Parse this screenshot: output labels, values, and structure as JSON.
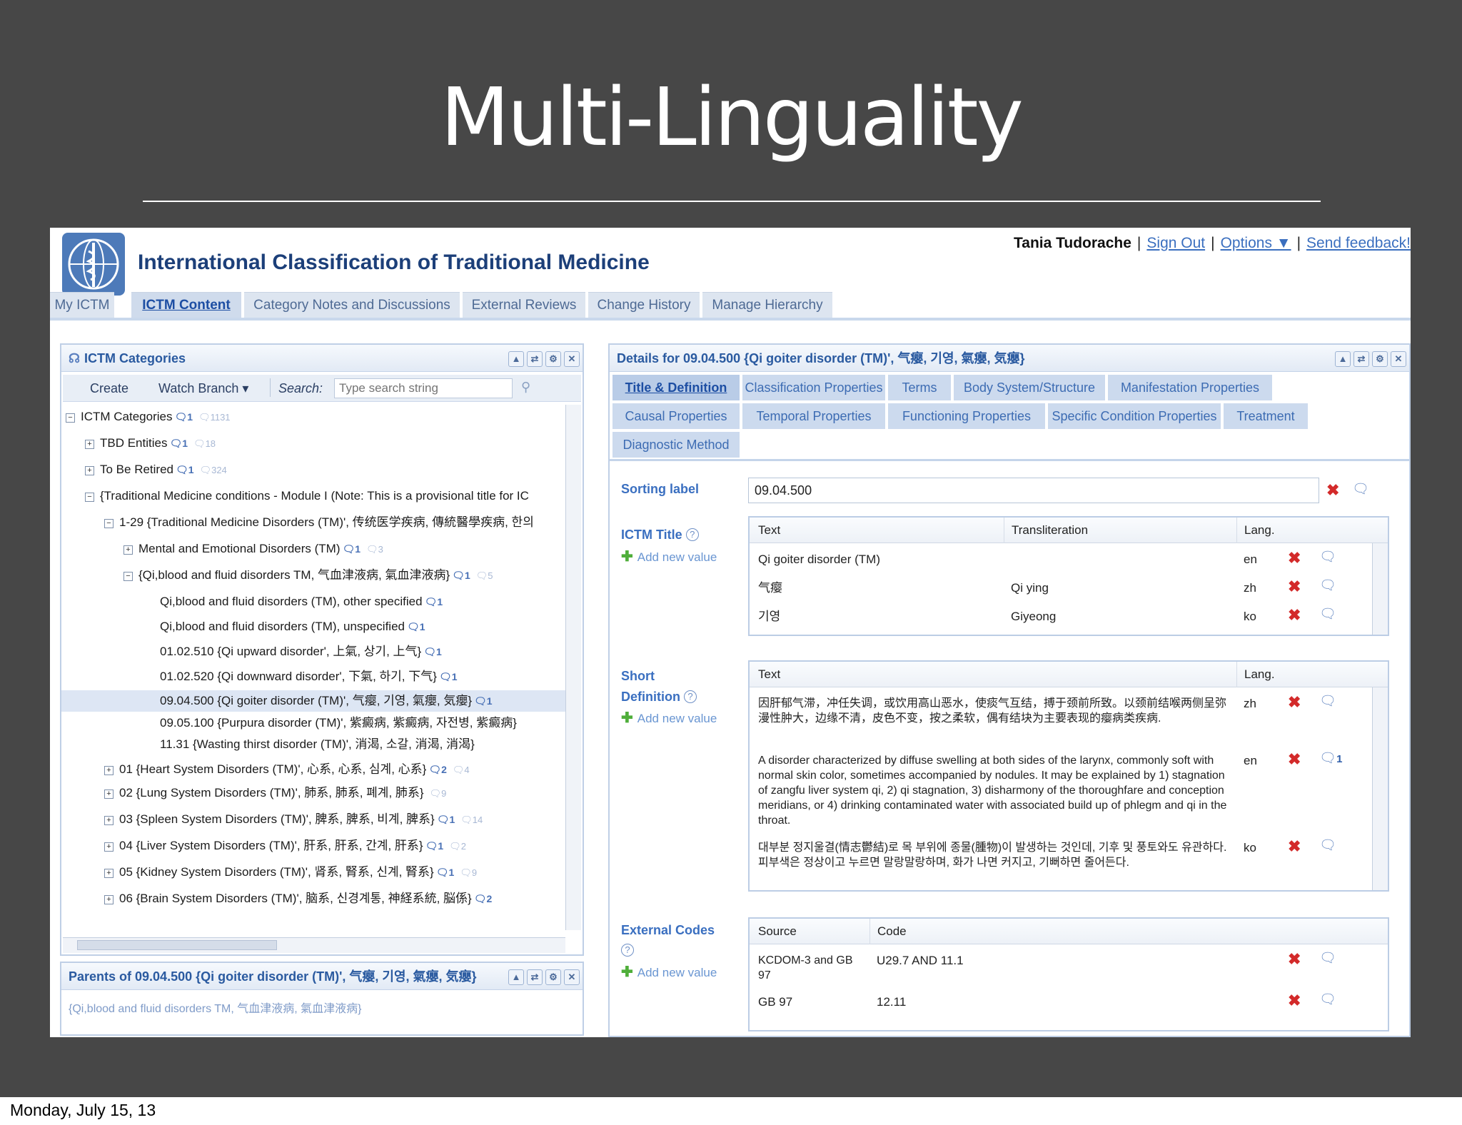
{
  "slide": {
    "title": "Multi-Linguality",
    "footer": "Monday, July 15, 13"
  },
  "app": {
    "title": "International Classification of Traditional Medicine",
    "user": "Tania Tudorache",
    "sign_out": "Sign Out",
    "options": "Options ▼",
    "feedback": "Send feedback!",
    "tabs": [
      "My ICTM",
      "ICTM Content",
      "Category Notes and Discussions",
      "External Reviews",
      "Change History",
      "Manage Hierarchy"
    ]
  },
  "tree_panel": {
    "title": "ICTM Categories",
    "create": "Create",
    "watch": "Watch Branch ▾",
    "search_label": "Search:",
    "search_placeholder": "Type search string",
    "rows": [
      {
        "text": "ICTM Categories",
        "n": "1",
        "m": "1131"
      },
      {
        "text": "TBD Entities",
        "n": "1",
        "m": "18"
      },
      {
        "text": "To Be Retired",
        "n": "1",
        "m": "324"
      },
      {
        "text": "{Traditional Medicine conditions - Module I (Note: This is a provisional title for IC",
        "n": "",
        "m": ""
      },
      {
        "text": "1-29 {Traditional Medicine Disorders (TM)', 传统医学疾病, 傳統醫學疾病, 한의",
        "n": "",
        "m": ""
      },
      {
        "text": "Mental and Emotional Disorders (TM)",
        "n": "1",
        "m": "3"
      },
      {
        "text": "{Qi,blood and fluid disorders TM, 气血津液病, 氣血津液病}",
        "n": "1",
        "m": "5"
      },
      {
        "text": "Qi,blood and fluid disorders (TM), other specified",
        "n": "1",
        "m": ""
      },
      {
        "text": "Qi,blood and fluid disorders (TM), unspecified",
        "n": "1",
        "m": ""
      },
      {
        "text": "01.02.510 {Qi upward disorder', 上氣, 상기, 上气}",
        "n": "1",
        "m": ""
      },
      {
        "text": "01.02.520 {Qi downward disorder', 下氣, 하기, 下气}",
        "n": "1",
        "m": ""
      },
      {
        "text": "09.04.500 {Qi goiter disorder (TM)', 气瘿, 기영, 氣癭, 気癭}",
        "n": "1",
        "m": ""
      },
      {
        "text": "09.05.100 {Purpura disorder (TM)', 紫癜病, 紫癜病, 자전병, 紫癜病}",
        "n": "",
        "m": ""
      },
      {
        "text": "11.31 {Wasting thirst disorder (TM)', 消渴, 소갈, 消渴, 消渴}",
        "n": "",
        "m": ""
      },
      {
        "text": "01 {Heart System Disorders (TM)', 心系, 心系, 심계, 心系}",
        "n": "2",
        "m": "4"
      },
      {
        "text": "02 {Lung System Disorders (TM)', 肺系, 肺系, 폐계, 肺系}",
        "n": "",
        "m": "9"
      },
      {
        "text": "03 {Spleen System Disorders (TM)', 脾系, 脾系, 비계, 脾系}",
        "n": "1",
        "m": "14"
      },
      {
        "text": "04 {Liver System Disorders (TM)', 肝系, 肝系, 간계, 肝系}",
        "n": "1",
        "m": "2"
      },
      {
        "text": "05 {Kidney System Disorders (TM)', 肾系, 腎系, 신계, 腎系}",
        "n": "1",
        "m": "9"
      },
      {
        "text": "06 {Brain System Disorders (TM)', 脑系, 신경계통, 神経系統, 脳係}",
        "n": "2",
        "m": ""
      }
    ]
  },
  "parents_panel": {
    "title": "Parents of 09.04.500 {Qi goiter disorder (TM)', 气瘿, 기영, 氣癭, 気癭}",
    "value": "{Qi,blood and fluid disorders TM, 气血津液病, 氣血津液病}"
  },
  "details": {
    "title": "Details for 09.04.500 {Qi goiter disorder (TM)', 气瘿, 기영, 氣癭, 気癭}",
    "tabs": [
      "Title & Definition",
      "Classification Properties",
      "Terms",
      "Body System/Structure",
      "Manifestation Properties",
      "Causal Properties",
      "Temporal Properties",
      "Functioning Properties",
      "Specific Condition Properties",
      "Treatment",
      "Diagnostic Method"
    ],
    "sorting_label": "Sorting label",
    "sorting_value": "09.04.500",
    "ictm_title": "ICTM Title",
    "add_value": "Add new value",
    "title_headers": [
      "Text",
      "Transliteration",
      "Lang."
    ],
    "title_rows": [
      {
        "text": "Qi goiter disorder (TM)",
        "translit": "",
        "lang": "en"
      },
      {
        "text": "气瘿",
        "translit": "Qi ying",
        "lang": "zh"
      },
      {
        "text": "기영",
        "translit": "Giyeong",
        "lang": "ko"
      }
    ],
    "short_def_1": "Short",
    "short_def_2": "Definition",
    "def_headers": [
      "Text",
      "Lang."
    ],
    "def_rows": [
      {
        "text": "因肝郁气滞，冲任失调，或饮用高山恶水，使痰气互结，搏于颈前所致。以颈前结喉两侧呈弥漫性肿大，边缘不清，皮色不变，按之柔软，偶有结块为主要表现的瘿病类疾病.",
        "lang": "zh",
        "n": ""
      },
      {
        "text": "A disorder characterized by diffuse swelling at both sides of the larynx, commonly soft with normal skin color, sometimes accompanied by nodules. It may be explained by 1) stagnation of zangfu liver system qi, 2) qi stagnation, 3) disharmony of the thoroughfare and conception meridians, or 4) drinking contaminated water with associated build up of phlegm and qi in the throat.",
        "lang": "en",
        "n": "1"
      },
      {
        "text": "대부분 정지울결(情志鬱結)로 목 부위에 종물(腫物)이 발생하는 것인데, 기후 및 풍토와도 유관하다. 피부색은 정상이고 누르면 말랑말랑하며, 화가 나면 커지고, 기뻐하면 줄어든다.",
        "lang": "ko",
        "n": ""
      }
    ],
    "external_codes": "External Codes",
    "code_headers": [
      "Source",
      "Code"
    ],
    "code_rows": [
      {
        "source": "KCDOM-3 and GB 97",
        "code": "U29.7 AND 11.1"
      },
      {
        "source": "GB 97",
        "code": "12.11"
      }
    ]
  },
  "colors": {
    "slide_bg": "#474747",
    "app_title": "#1c3f79",
    "link": "#3b6fbf",
    "delete": "#d32a2a"
  }
}
